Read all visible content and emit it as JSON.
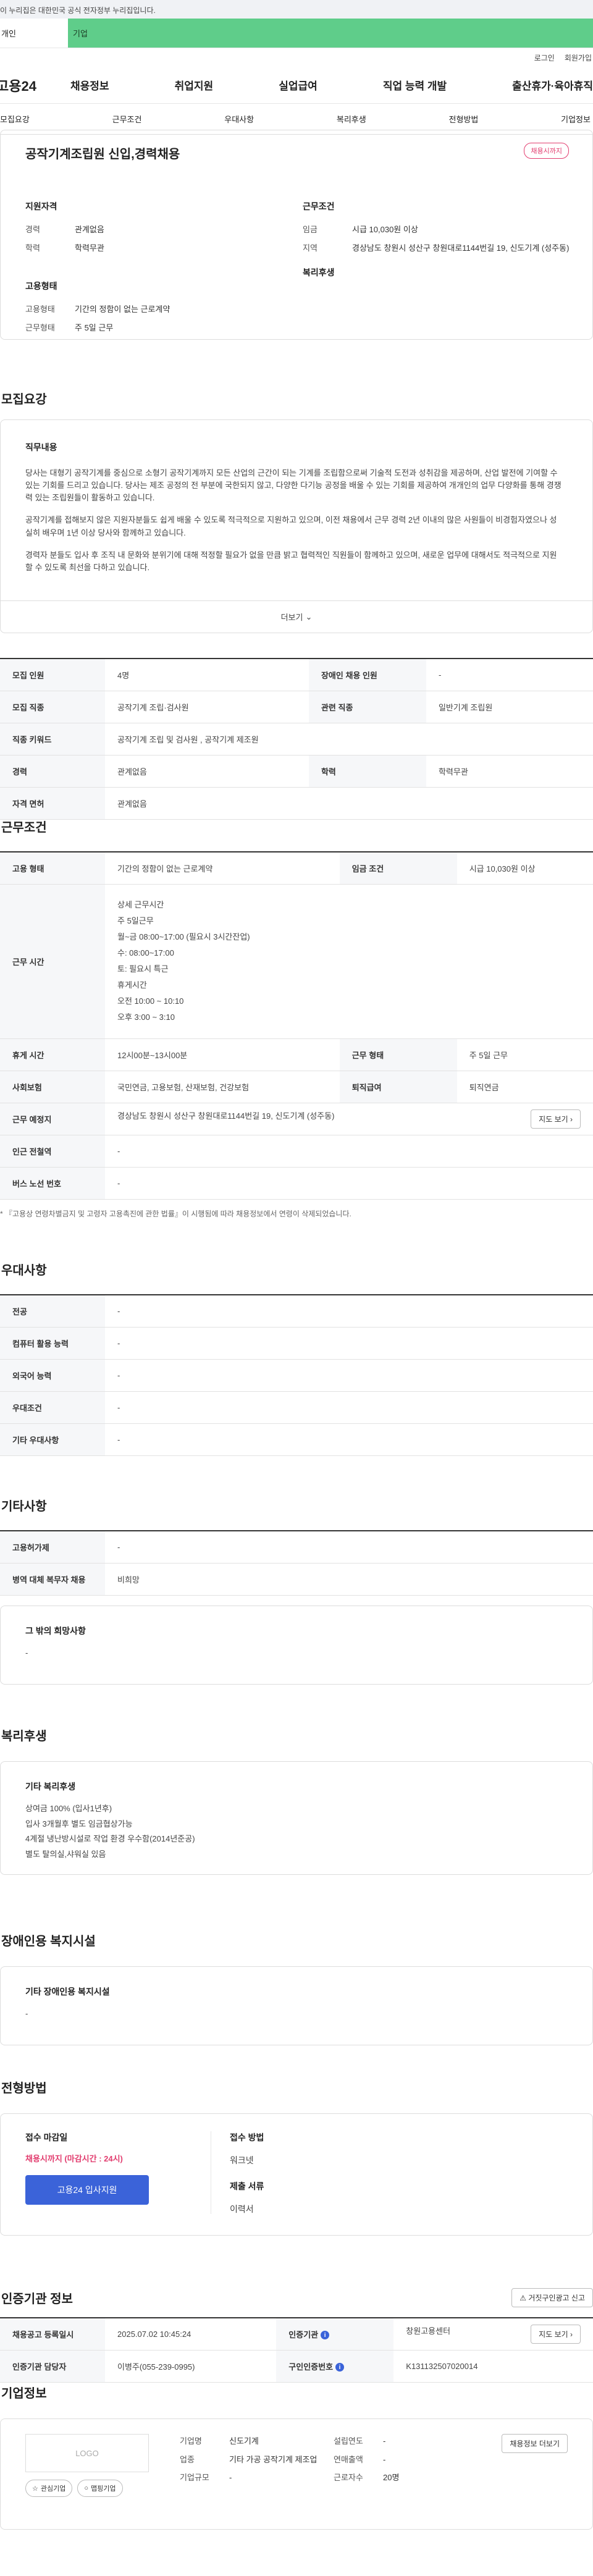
{
  "gov_banner": "이 누리집은 대한민국 공식 전자정부 누리집입니다.",
  "topbar": {
    "individual": "개인",
    "company": "기업"
  },
  "util": {
    "login": "로그인",
    "signup": "회원가입"
  },
  "gnb": {
    "logo": "고용24",
    "menu": [
      "채용정보",
      "취업지원",
      "실업급여",
      "직업 능력 개발",
      "출산휴가·육아휴직"
    ]
  },
  "subnav": [
    "모집요강",
    "근무조건",
    "우대사항",
    "복리후생",
    "전형방법",
    "기업정보"
  ],
  "job": {
    "title": "공작기계조립원 신입,경력채용",
    "badge": "채용시까지",
    "qual_head": "지원자격",
    "qual": [
      {
        "k": "경력",
        "v": "관계없음"
      },
      {
        "k": "학력",
        "v": "학력무관"
      }
    ],
    "cond_head": "근무조건",
    "cond": [
      {
        "k": "임금",
        "v": "시급 10,030원 이상"
      },
      {
        "k": "지역",
        "v": "경상남도 창원시 성산구 창원대로1144번길 19, 신도기계 (성주동)"
      }
    ],
    "emp_head": "고용형태",
    "emp": [
      {
        "k": "고용형태",
        "v": "기간의 정함이 없는 근로계약"
      },
      {
        "k": "근무형태",
        "v": "주 5일 근무"
      }
    ],
    "welfare_head": "복리후생"
  },
  "recruit": {
    "title": "모집요강",
    "desc_head": "직무내용",
    "desc_p1": "당사는 대형기 공작기계를 중심으로 소형기 공작기계까지 모든 산업의 근간이 되는 기계를 조립함으로써 기술적 도전과 성취감을 제공하며, 산업 발전에 기여할 수 있는 기회를 드리고 있습니다. 당사는 제조 공정의 전 부분에 국한되지 않고, 다양한 다기능 공정을 배울 수 있는 기회를 제공하여 개개인의 업무 다양화를 통해 경쟁력 있는 조립원들이 활동하고 있습니다.",
    "desc_p2": "공작기계를 접해보지 않은 지원자분들도 쉽게 배울 수 있도록 적극적으로 지원하고 있으며, 이전 채용에서 근무 경력 2년 이내의 많은 사원들이 비경험자였으나 성실히 배우며 1년 이상 당사와 함께하고 있습니다.",
    "desc_p3": "경력자 분들도 입사 후 조직 내 문화와 분위기에 대해 적정할 필요가 없을 만큼 밝고 협력적인 직원들이 함께하고 있으며, 새로운 업무에 대해서도 적극적으로 지원할 수 있도록 최선을 다하고 있습니다.",
    "more": "더보기",
    "rows": [
      {
        "k1": "모집 인원",
        "v1": "4명",
        "k2": "장애인 채용 인원",
        "v2": "-"
      },
      {
        "k1": "모집 직종",
        "v1": "공작기계 조립·검사원",
        "k2": "관련 직종",
        "v2": "일반기계 조립원"
      },
      {
        "k1": "직종 키워드",
        "v1": "공작기계 조립 및 검사원 , 공작기계 제조원"
      },
      {
        "k1": "경력",
        "v1": "관계없음",
        "k2": "학력",
        "v2": "학력무관"
      },
      {
        "k1": "자격 면허",
        "v1": "관계없음"
      }
    ]
  },
  "work": {
    "title": "근무조건",
    "emp_k": "고용 형태",
    "emp_v": "기간의 정함이 없는 근로계약",
    "wage_k": "임금 조건",
    "wage_v": "시급 10,030원 이상",
    "time_k": "근무 시간",
    "time_lines": [
      "상세 근무시간",
      "주 5일근무",
      "월~금 08:00~17:00 (필요시 3시간잔업)",
      "수: 08:00~17:00",
      "토: 필요시 특근",
      "휴게시간",
      "오전 10:00 ~ 10:10",
      "오후 3:00 ~ 3:10"
    ],
    "rest_k": "휴게 시간",
    "rest_v": "12시00분~13시00분",
    "type_k": "근무 형태",
    "type_v": "주 5일 근무",
    "ins_k": "사회보험",
    "ins_v": "국민연금, 고용보험, 산재보험, 건강보험",
    "ret_k": "퇴직급여",
    "ret_v": "퇴직연금",
    "place_k": "근무 예정지",
    "place_v": "경상남도 창원시 성산구 창원대로1144번길 19, 신도기계 (성주동)",
    "map_btn": "지도 보기",
    "sub_k": "인근 전철역",
    "sub_v": "-",
    "bus_k": "버스 노선 번호",
    "bus_v": "-",
    "note": "* 『고용상 연령차별금지 및 고령자 고용촉진에 관한 법률』이 시행됨에 따라 채용정보에서 연령이 삭제되었습니다."
  },
  "pref": {
    "title": "우대사항",
    "rows": [
      {
        "k": "전공",
        "v": "-"
      },
      {
        "k": "컴퓨터 활용 능력",
        "v": "-"
      },
      {
        "k": "외국어 능력",
        "v": "-"
      },
      {
        "k": "우대조건",
        "v": "-"
      },
      {
        "k": "기타 우대사항",
        "v": "-"
      }
    ]
  },
  "etc": {
    "title": "기타사항",
    "rows": [
      {
        "k": "고용허가제",
        "v": "-"
      },
      {
        "k": "병역 대체 복무자 채용",
        "v": "비희망"
      }
    ],
    "box_h": "그 밖의 희망사항",
    "box_v": "-"
  },
  "welfare": {
    "title": "복리후생",
    "box_h": "기타 복리후생",
    "lines": [
      "상여금 100% (입사1년후)",
      "입사 3개월후 별도 임금협상가능",
      "4계절 냉난방시설로 작업 환경 우수함(2014년준공)",
      "별도 탈의실,샤워실 있음"
    ]
  },
  "disabled": {
    "title": "장애인용 복지시설",
    "box_h": "기타 장애인용 복지시설",
    "box_v": "-"
  },
  "apply": {
    "title": "전형방법",
    "deadline_h": "접수 마감일",
    "deadline_v": "채용시까지 (마감시간 : 24시)",
    "btn": "고용24 입사지원",
    "method_h": "접수 방법",
    "method_v": "워크넷",
    "docs_h": "제출 서류",
    "docs_v": "이력서"
  },
  "agency": {
    "title": "인증기관 정보",
    "report_btn": "거짓구인광고 신고",
    "reg_k": "채용공고 등록일시",
    "reg_v": "2025.07.02 10:45:24",
    "org_k": "인증기관",
    "org_v": "창원고용센터",
    "map_btn": "지도 보기",
    "mgr_k": "인증기관 담당자",
    "mgr_v": "이병주(055-239-0995)",
    "id_k": "구인인증번호",
    "id_v": "K131132507020014"
  },
  "company": {
    "title": "기업정보",
    "logo": "LOGO",
    "fav_btn": "관심기업",
    "map_btn": "맵핑기업",
    "name_k": "기업명",
    "name_v": "신도기계",
    "ind_k": "업종",
    "ind_v": "기타 가공 공작기계 제조업",
    "size_k": "기업규모",
    "size_v": "-",
    "year_k": "설립연도",
    "year_v": "-",
    "sales_k": "연매출액",
    "sales_v": "-",
    "emp_k": "근로자수",
    "emp_v": "20명",
    "more_btn": "채용정보 더보기"
  }
}
